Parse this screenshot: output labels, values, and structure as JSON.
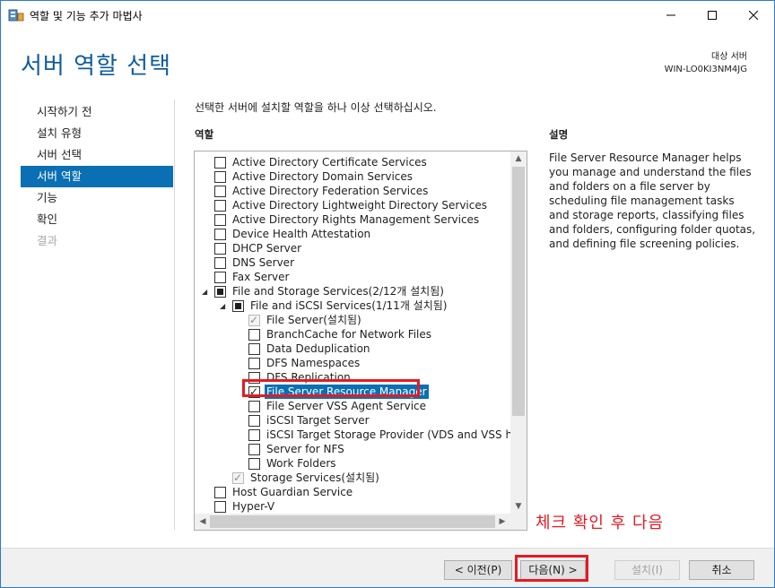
{
  "window": {
    "title": "역할 및 기능 추가 마법사",
    "controls": {
      "minimize": "minimize-icon",
      "maximize": "maximize-icon",
      "close": "close-icon"
    }
  },
  "header": {
    "title": "서버 역할 선택",
    "target_label": "대상 서버",
    "target_server": "WIN-LO0KI3NM4JG"
  },
  "sidebar": {
    "items": [
      {
        "label": "시작하기 전",
        "state": "normal"
      },
      {
        "label": "설치 유형",
        "state": "normal"
      },
      {
        "label": "서버 선택",
        "state": "normal"
      },
      {
        "label": "서버 역할",
        "state": "active"
      },
      {
        "label": "기능",
        "state": "normal"
      },
      {
        "label": "확인",
        "state": "normal"
      },
      {
        "label": "결과",
        "state": "disabled"
      }
    ]
  },
  "main": {
    "instruction": "선택한 서버에 설치할 역할을 하나 이상 선택하십시오.",
    "roles_header": "역할",
    "description_header": "설명",
    "description": "File Server Resource Manager helps you manage and understand the files and folders on a file server by scheduling file management tasks and storage reports, classifying files and folders, configuring folder quotas, and defining file screening policies."
  },
  "roles": [
    {
      "label": "Active Directory Certificate Services",
      "level": 0,
      "state": "unchecked"
    },
    {
      "label": "Active Directory Domain Services",
      "level": 0,
      "state": "unchecked"
    },
    {
      "label": "Active Directory Federation Services",
      "level": 0,
      "state": "unchecked"
    },
    {
      "label": "Active Directory Lightweight Directory Services",
      "level": 0,
      "state": "unchecked"
    },
    {
      "label": "Active Directory Rights Management Services",
      "level": 0,
      "state": "unchecked"
    },
    {
      "label": "Device Health Attestation",
      "level": 0,
      "state": "unchecked"
    },
    {
      "label": "DHCP Server",
      "level": 0,
      "state": "unchecked"
    },
    {
      "label": "DNS Server",
      "level": 0,
      "state": "unchecked"
    },
    {
      "label": "Fax Server",
      "level": 0,
      "state": "unchecked"
    },
    {
      "label": "File and Storage Services(2/12개 설치됨)",
      "level": 0,
      "state": "partial",
      "expander": true
    },
    {
      "label": "File and iSCSI Services(1/11개 설치됨)",
      "level": 1,
      "state": "partial",
      "expander": true
    },
    {
      "label": "File Server(설치됨)",
      "level": 2,
      "state": "checked-disabled"
    },
    {
      "label": "BranchCache for Network Files",
      "level": 2,
      "state": "unchecked"
    },
    {
      "label": "Data Deduplication",
      "level": 2,
      "state": "unchecked"
    },
    {
      "label": "DFS Namespaces",
      "level": 2,
      "state": "unchecked"
    },
    {
      "label": "DFS Replication",
      "level": 2,
      "state": "unchecked"
    },
    {
      "label": "File Server Resource Manager",
      "level": 2,
      "state": "checked",
      "selected": true
    },
    {
      "label": "File Server VSS Agent Service",
      "level": 2,
      "state": "unchecked"
    },
    {
      "label": "iSCSI Target Server",
      "level": 2,
      "state": "unchecked"
    },
    {
      "label": "iSCSI Target Storage Provider (VDS and VSS hardware)",
      "level": 2,
      "state": "unchecked"
    },
    {
      "label": "Server for NFS",
      "level": 2,
      "state": "unchecked"
    },
    {
      "label": "Work Folders",
      "level": 2,
      "state": "unchecked"
    },
    {
      "label": "Storage Services(설치됨)",
      "level": 1,
      "state": "checked-disabled"
    },
    {
      "label": "Host Guardian Service",
      "level": 0,
      "state": "unchecked"
    },
    {
      "label": "Hyper-V",
      "level": 0,
      "state": "unchecked"
    }
  ],
  "annotation": "체크 확인 후 다음",
  "footer": {
    "prev": "< 이전(P)",
    "next": "다음(N) >",
    "install": "설치(I)",
    "cancel": "취소"
  },
  "colors": {
    "accent": "#0a6fb3",
    "title_blue": "#0f5c9e",
    "annotation_red": "#e31b23"
  }
}
